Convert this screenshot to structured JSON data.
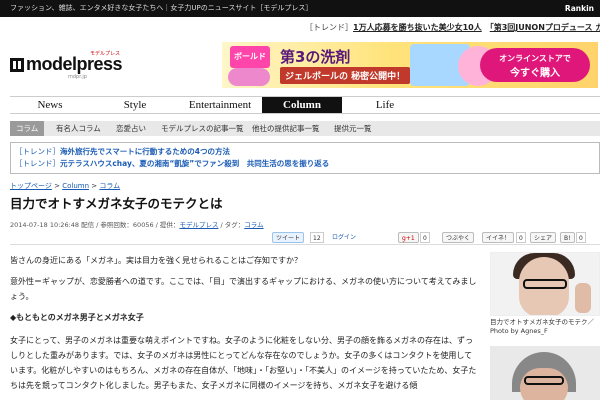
{
  "topbar": {
    "left_text": "ファッション、雑誌、エンタメ好きな女子たちへ｜女子力UPのニュースサイト［モデルプレス］",
    "right_text": "Rankin"
  },
  "ticker": {
    "tag": "［トレンド］",
    "headline": "1万人応募を勝ち抜いた美少女10人",
    "rest": "「第3回JUNONプロデュース ガールズコ"
  },
  "logo": {
    "word": "modelpress",
    "sub": "モデルプレス",
    "tag": "mdpr.jp"
  },
  "banner": {
    "brand": "ボールド",
    "headline": "第3の洗剤",
    "sub": "ジェルボールの 秘密公開中！",
    "cta_line1": "オンラインストアで",
    "cta_line2": "今すぐ購入"
  },
  "mainnav": [
    "News",
    "Style",
    "Entertainment",
    "Column",
    "Life"
  ],
  "mainnav_active": "Column",
  "subnav": [
    "コラム",
    "有名人コラム",
    "恋愛占い",
    "モデルプレスの記事一覧",
    "他社の提供記事一覧",
    "提供元一覧"
  ],
  "trends": [
    {
      "tag": "［トレンド］",
      "link": "海外旅行先でスマートに行動するための4つの方法"
    },
    {
      "tag": "［トレンド］",
      "link": "元テラスハウスchay、夏の湘南“凱旋”でファン殺到　共同生活の思を振り返る"
    }
  ],
  "breadcrumb": {
    "items": [
      "トップページ",
      "Column",
      "コラム"
    ],
    "sep": " > "
  },
  "title": "目力でオトすメガネ女子のモテクとは",
  "meta": {
    "prefix": "2014-07-18 10:26:48 配信 / 参照回数：60056 / 提供：",
    "provider": "モデルプレス",
    "tag_label": " / タグ：",
    "tag": "コラム"
  },
  "social": {
    "tweet": "ツイート",
    "tweet_count": "12",
    "login": "ログイン",
    "gplus": "g+1",
    "gplus_count": "0",
    "tsubuyaku": "つぶやく",
    "iine": "イイネ！",
    "iine_count": "0",
    "share": "シェア",
    "btn3_count": "0"
  },
  "article": {
    "p1": "皆さんの身近にある「メガネ」。実は目力を強く見せられることはご存知ですか？",
    "p2": "意外性＝ギャップが、恋愛勝者への道です。ここでは、「目」で演出するギャップにおける、メガネの使い方について考えてみましょう。",
    "heading": "◆もともとのメガネ男子とメガネ女子",
    "p3": "女子にとって、男子のメガネは重要な萌えポイントですね。女子のように化粧をしない分、男子の顔を飾るメガネの存在は、ずっしりとした重みがあります。では、女子のメガネは男性にとってどんな存在なのでしょうか。女子の多くはコンタクトを使用しています。化粧がしやすいのはもちろん、メガネの存在自体が、「地味」・「お堅い」・「不美人」のイメージを持っていたため、女子たちは先を競ってコンタクト化しました。男子もまた、女子メガネに同様のイメージを持ち、メガネ女子を避ける傾"
  },
  "side": {
    "caption": "目力でオトすメガネ女子のモテク／Photo by Agnes_F"
  }
}
